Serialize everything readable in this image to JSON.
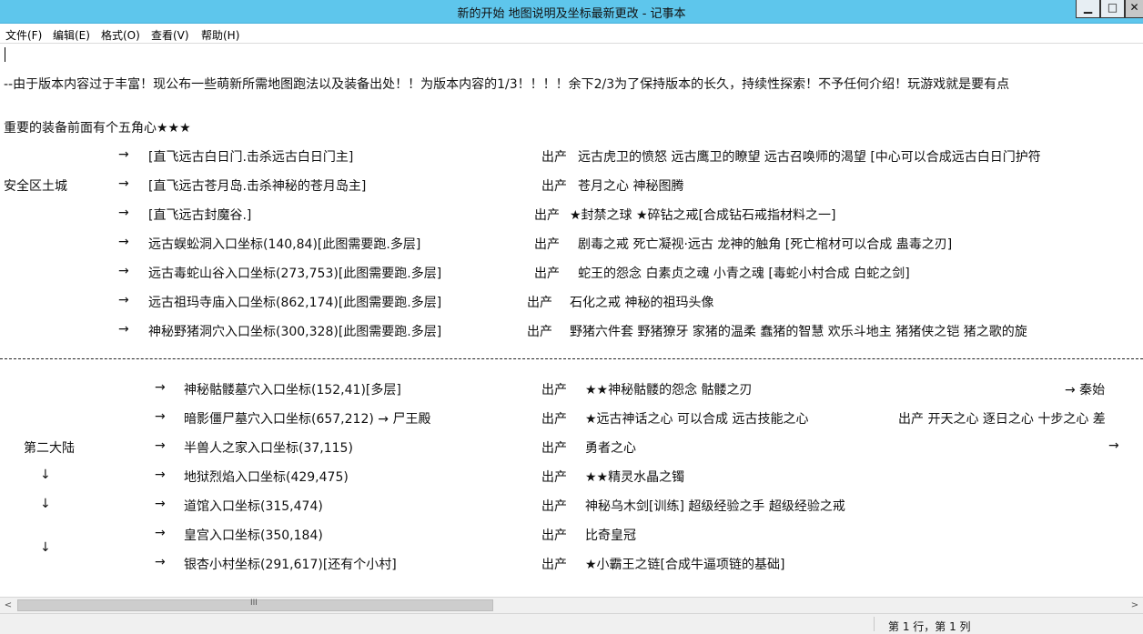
{
  "window": {
    "title": "新的开始 地图说明及坐标最新更改 - 记事本",
    "minimize_glyph": "▁",
    "maximize_glyph": "□",
    "close_glyph": "✕"
  },
  "menu": [
    "文件(F)",
    "编辑(E)",
    "格式(O)",
    "查看(V)",
    "帮助(H)"
  ],
  "content": {
    "intro": "--由于版本内容过于丰富！现公布一些萌新所需地图跑法以及装备出处！！为版本内容的1/3！！！！余下2/3为了保持版本的长久，持续性探索！不予任何介绍！玩游戏就是要有点",
    "star_note": "重要的装备前面有个五角心★★★",
    "section1_label": "安全区土城",
    "section1_rows": [
      {
        "arrow": "→",
        "name": "[直飞远古白日门.击杀远古白日门主]",
        "out": "出产",
        "drops": "远古虎卫的愤怒   远古鹰卫的瞭望   远古召唤师的渴望    [中心可以合成远古白日门护符"
      },
      {
        "arrow": "→",
        "name": "[直飞远古苍月岛.击杀神秘的苍月岛主]",
        "out": "出产",
        "drops": "苍月之心   神秘图腾"
      },
      {
        "arrow": "→",
        "name": "[直飞远古封魔谷.]",
        "out": "出产",
        "drops": "★封禁之球     ★碎钻之戒[合成钻石戒指材料之一]"
      },
      {
        "arrow": "→",
        "name": "远古蜈蚣洞入口坐标(140,84)[此图需要跑.多层]",
        "out": "出产",
        "drops": "剧毒之戒   死亡凝视·远古   龙神的触角   [死亡棺材可以合成 蛊毒之刃]"
      },
      {
        "arrow": "→",
        "name": "远古毒蛇山谷入口坐标(273,753)[此图需要跑.多层]",
        "out": "出产",
        "drops": "蛇王的怨念 白素贞之魂 小青之魂     [毒蛇小村合成  白蛇之剑]"
      },
      {
        "arrow": "→",
        "name": "远古祖玛寺庙入口坐标(862,174)[此图需要跑.多层]",
        "out": "出产",
        "drops": "石化之戒   神秘的祖玛头像"
      },
      {
        "arrow": "→",
        "name": "神秘野猪洞穴入口坐标(300,328)[此图需要跑.多层]",
        "out": "出产",
        "drops": "野猪六件套   野猪獠牙   家猪的温柔   蠢猪的智慧   欢乐斗地主   猪猪侠之铠   猪之歌的旋"
      }
    ],
    "section2_label": "第二大陆",
    "down_arrow": "↓",
    "section2_rows": [
      {
        "arrow": "→",
        "name": "神秘骷髅墓穴入口坐标(152,41)[多层]",
        "out": "出产",
        "drops": "★★神秘骷髅的怨念  骷髅之刃",
        "extra": "→      秦始"
      },
      {
        "arrow": "→",
        "name": "暗影僵尸墓穴入口坐标(657,212) → 尸王殿",
        "out": "出产",
        "drops": "★远古神话之心   可以合成   远古技能之心",
        "extra": "出产   开天之心  逐日之心  十步之心  差"
      },
      {
        "arrow": "→",
        "name": "半兽人之家入口坐标(37,115)",
        "out": "出产",
        "drops": "勇者之心",
        "extra": "→"
      },
      {
        "arrow": "→",
        "name": "地狱烈焰入口坐标(429,475)",
        "out": "出产",
        "drops": "★★精灵水晶之镯"
      },
      {
        "arrow": "→",
        "name": "道馆入口坐标(315,474)",
        "out": "出产",
        "drops": "神秘乌木剑[训练]   超级经验之手    超级经验之戒"
      },
      {
        "arrow": "→",
        "name": "皇宫入口坐标(350,184)",
        "out": "出产",
        "drops": "比奇皇冠"
      },
      {
        "arrow": "→",
        "name": "银杏小村坐标(291,617)[还有个小村]",
        "out": "出产",
        "drops": "★小霸王之链[合成牛逼项链的基础]"
      }
    ]
  },
  "scrollbar": {
    "grip": "III",
    "left_arrow": "<",
    "right_arrow": ">"
  },
  "status": {
    "position": "第 1 行，第 1 列"
  }
}
